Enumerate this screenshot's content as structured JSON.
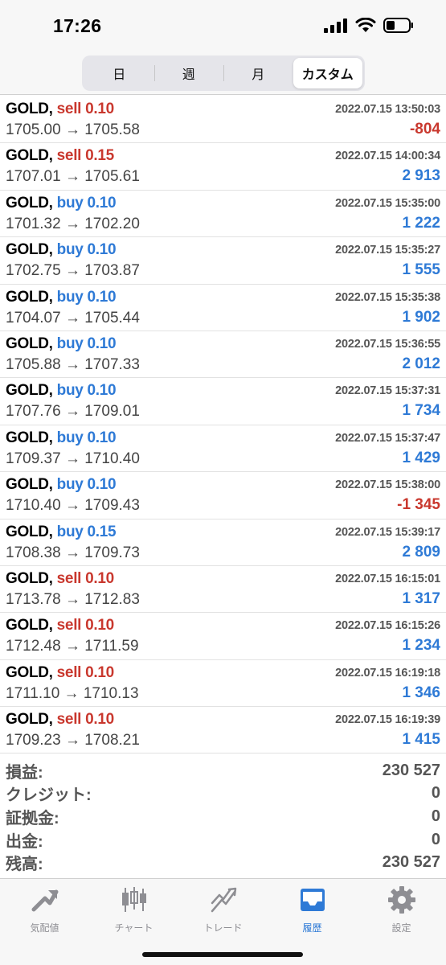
{
  "status_bar": {
    "time": "17:26"
  },
  "period_tabs": [
    {
      "label": "日",
      "active": false
    },
    {
      "label": "週",
      "active": false
    },
    {
      "label": "月",
      "active": false
    },
    {
      "label": "カスタム",
      "active": true
    }
  ],
  "trades": [
    {
      "symbol": "GOLD,",
      "side": "sell",
      "volume": "0.10",
      "prices": "1705.00 → 1705.58",
      "time": "2022.07.15 13:50:03",
      "profit": "-804"
    },
    {
      "symbol": "GOLD,",
      "side": "sell",
      "volume": "0.15",
      "prices": "1707.01 → 1705.61",
      "time": "2022.07.15 14:00:34",
      "profit": "2 913"
    },
    {
      "symbol": "GOLD,",
      "side": "buy",
      "volume": "0.10",
      "prices": "1701.32 → 1702.20",
      "time": "2022.07.15 15:35:00",
      "profit": "1 222"
    },
    {
      "symbol": "GOLD,",
      "side": "buy",
      "volume": "0.10",
      "prices": "1702.75 → 1703.87",
      "time": "2022.07.15 15:35:27",
      "profit": "1 555"
    },
    {
      "symbol": "GOLD,",
      "side": "buy",
      "volume": "0.10",
      "prices": "1704.07 → 1705.44",
      "time": "2022.07.15 15:35:38",
      "profit": "1 902"
    },
    {
      "symbol": "GOLD,",
      "side": "buy",
      "volume": "0.10",
      "prices": "1705.88 → 1707.33",
      "time": "2022.07.15 15:36:55",
      "profit": "2 012"
    },
    {
      "symbol": "GOLD,",
      "side": "buy",
      "volume": "0.10",
      "prices": "1707.76 → 1709.01",
      "time": "2022.07.15 15:37:31",
      "profit": "1 734"
    },
    {
      "symbol": "GOLD,",
      "side": "buy",
      "volume": "0.10",
      "prices": "1709.37 → 1710.40",
      "time": "2022.07.15 15:37:47",
      "profit": "1 429"
    },
    {
      "symbol": "GOLD,",
      "side": "buy",
      "volume": "0.10",
      "prices": "1710.40 → 1709.43",
      "time": "2022.07.15 15:38:00",
      "profit": "-1 345"
    },
    {
      "symbol": "GOLD,",
      "side": "buy",
      "volume": "0.15",
      "prices": "1708.38 → 1709.73",
      "time": "2022.07.15 15:39:17",
      "profit": "2 809"
    },
    {
      "symbol": "GOLD,",
      "side": "sell",
      "volume": "0.10",
      "prices": "1713.78 → 1712.83",
      "time": "2022.07.15 16:15:01",
      "profit": "1 317"
    },
    {
      "symbol": "GOLD,",
      "side": "sell",
      "volume": "0.10",
      "prices": "1712.48 → 1711.59",
      "time": "2022.07.15 16:15:26",
      "profit": "1 234"
    },
    {
      "symbol": "GOLD,",
      "side": "sell",
      "volume": "0.10",
      "prices": "1711.10 → 1710.13",
      "time": "2022.07.15 16:19:18",
      "profit": "1 346"
    },
    {
      "symbol": "GOLD,",
      "side": "sell",
      "volume": "0.10",
      "prices": "1709.23 → 1708.21",
      "time": "2022.07.15 16:19:39",
      "profit": "1 415"
    }
  ],
  "summary": [
    {
      "label": "損益:",
      "value": "230 527"
    },
    {
      "label": "クレジット:",
      "value": "0"
    },
    {
      "label": "証拠金:",
      "value": "0"
    },
    {
      "label": "出金:",
      "value": "0"
    },
    {
      "label": "残高:",
      "value": "230 527"
    }
  ],
  "tab_bar": [
    {
      "label": "気配値",
      "icon": "quotes-icon",
      "active": false
    },
    {
      "label": "チャート",
      "icon": "chart-icon",
      "active": false
    },
    {
      "label": "トレード",
      "icon": "trade-icon",
      "active": false
    },
    {
      "label": "履歴",
      "icon": "history-icon",
      "active": true
    },
    {
      "label": "設定",
      "icon": "settings-icon",
      "active": false
    }
  ],
  "colors": {
    "sell": "#c9382e",
    "buy": "#2e7ad6",
    "loss": "#c9382e",
    "profit": "#2e7ad6",
    "tab_active": "#2e7ad6",
    "tab_inactive": "#8e8e93"
  }
}
